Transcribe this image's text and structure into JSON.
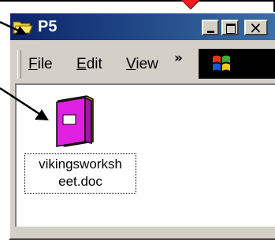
{
  "window": {
    "title": "P5",
    "title_icon": "folder-open-icon",
    "controls": {
      "minimize": "minimize-icon",
      "maximize": "maximize-icon",
      "close": "close-icon"
    },
    "close_glyph": "×"
  },
  "menu": {
    "items": [
      {
        "label": "File",
        "accel": "F"
      },
      {
        "label": "Edit",
        "accel": "E"
      },
      {
        "label": "View",
        "accel": "V"
      }
    ],
    "more": "»",
    "logo": "windows-logo-icon"
  },
  "file": {
    "name_line1": "vikingsworksh",
    "name_line2": "eet.doc",
    "icon": "book-document-icon"
  },
  "colors": {
    "titlebar": "#0a246a",
    "pointer": "#ef1d1d",
    "file_icon": "#e020e0"
  }
}
